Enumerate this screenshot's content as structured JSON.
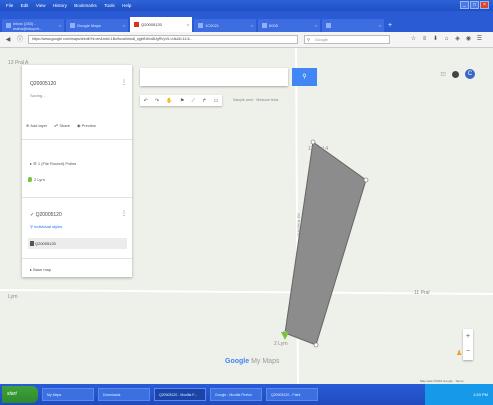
{
  "browser": {
    "menu": [
      "File",
      "Edit",
      "View",
      "History",
      "Bookmarks",
      "Tools",
      "Help"
    ],
    "tabs": [
      {
        "label": "Inbox (283) - mahu@nkcprit..."
      },
      {
        "label": "Google Maps"
      },
      {
        "label": "Q20005120",
        "active": true
      },
      {
        "label": "1C0021"
      },
      {
        "label": "6005"
      },
      {
        "label": ""
      }
    ],
    "url": "https://www.google.com/maps/d/edit?hl=en&mid=1Bo9uvaXnks8_vjgbEdVz8UgRVpVL=Uk&ll=14.8...",
    "search_placeholder": "Google"
  },
  "panel": {
    "title": "Q20005120",
    "subtitle": "Saving...",
    "actions": [
      "Add layer",
      "Share",
      "Preview"
    ],
    "layer1": "1 (File Routed) Polies",
    "layer1_item": "2 Lyrn",
    "layer2_title": "Q20005120",
    "layer2_style": "Individual styles",
    "layer2_item": "Q20005120",
    "basemap": "Base map"
  },
  "map": {
    "measure_hint": "Sample work · Measure tests",
    "labels": [
      "13 Pral A",
      "5 Lyrn B",
      "Lyrn",
      "13 Pral 4",
      "11 Pral",
      "2 Lyrn"
    ],
    "street_label": "Rd: Road Area",
    "brand": "Google My Maps",
    "copyright": "Map data ©2019 Google · Terms"
  },
  "account": {
    "avatar_letter": "C"
  },
  "taskbar": {
    "start": "start",
    "tasks": [
      "My Maps",
      "Downloads",
      "Q20005120 - Mozilla F...",
      "Google - Mozilla Firefox",
      "Q20005120 - Paint"
    ],
    "clock": "1:53 PM"
  },
  "colors": {
    "polygon": "#8c8c8c",
    "accent": "#4285f4",
    "marker": "#7cc242"
  }
}
